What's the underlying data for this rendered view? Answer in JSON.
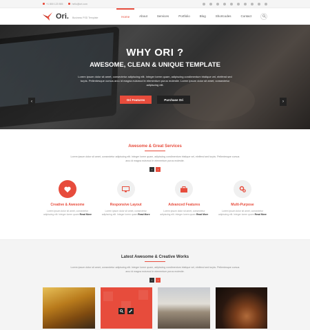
{
  "topbar": {
    "phone": "+1 800 123 555",
    "email": "hello@ori.com",
    "social_icons": [
      "facebook-icon",
      "twitter-icon",
      "google-plus-icon",
      "dribbble-icon",
      "behance-icon",
      "pinterest-icon",
      "linkedin-icon",
      "instagram-icon",
      "youtube-icon",
      "rss-icon"
    ]
  },
  "brand": {
    "name": "Ori.",
    "tagline": "Business PSD Template",
    "accent": "#e74c3c"
  },
  "nav": {
    "items": [
      "Home",
      "About",
      "Services",
      "Portfolio",
      "Blog",
      "Shortcodes",
      "Contact"
    ],
    "active": "Home"
  },
  "hero": {
    "title": "WHY ORI ?",
    "subtitle": "AWESOME, CLEAN & UNIQUE TEMPLATE",
    "text": "Lorem ipsum dolor sit amet, consectetur adipiscing elit. Integer lorem quam, adipiscing condimentum tristique vel, eleifend sed turpis. Pellentesque cursus arcu id magna euismod in elementum purus molestie. Lorem ipsum dolor sit amet, consectetur adipiscing elit.",
    "btn_primary": "Ori Features",
    "btn_secondary": "Purchase Ori",
    "prev": "‹",
    "next": "›"
  },
  "services": {
    "title": "Awesome & Great Services",
    "text": "Lorem ipsum dolor sit amet, consectetur adipiscing elit. Integer lorem quam, adipiscing condimentum tristique vel, eleifend sed turpis. Pellentesque cursus arcu id magna euismod in elementum purus molestie.",
    "pager_prev": "‹",
    "pager_next": "›",
    "items": [
      {
        "title": "Creative & Awesome",
        "text": "Lorem ipsum dolor sit amet, consectetur adipiscing elit. Integer lorem quam",
        "more": "Read More",
        "icon": "heart-icon"
      },
      {
        "title": "Responsive Layout",
        "text": "Lorem ipsum dolor sit amet, consectetur adipiscing elit. Integer lorem quam",
        "more": "Read More",
        "icon": "monitor-icon"
      },
      {
        "title": "Advanced Features",
        "text": "Lorem ipsum dolor sit amet, consectetur adipiscing elit. Integer lorem quam",
        "more": "Read More",
        "icon": "briefcase-icon"
      },
      {
        "title": "Multi-Purpose",
        "text": "Lorem ipsum dolor sit amet, consectetur adipiscing elit. Integer lorem quam",
        "more": "Read More",
        "icon": "gears-icon"
      }
    ]
  },
  "works": {
    "title": "Latest Awesome & Creative Works",
    "text": "Lorem ipsum dolor sit amet, consectetur adipiscing elit. Integer lorem quam, adipiscing condimentum tristique vel, eleifend sed turpis. Pellentesque cursus arcu id magna euismod in elementum purus molestie.",
    "pager_prev": "‹",
    "pager_next": "›"
  }
}
